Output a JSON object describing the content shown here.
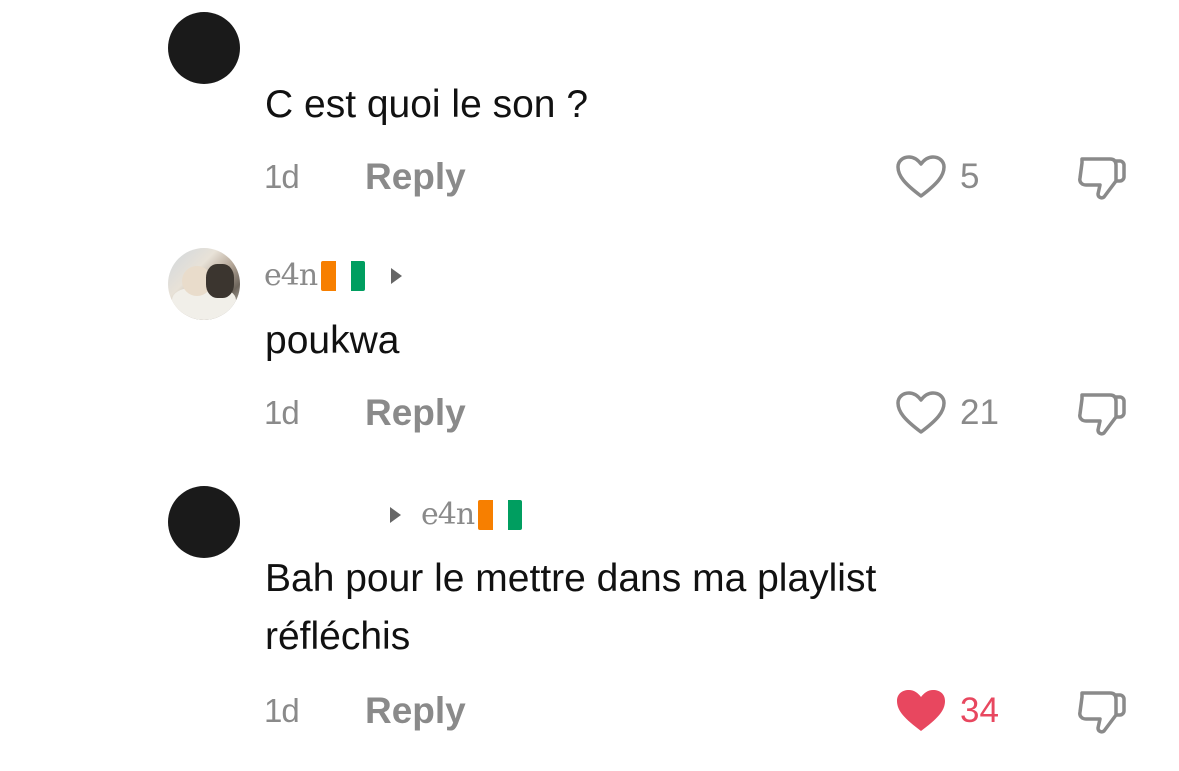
{
  "comments": [
    {
      "username": "",
      "text": "C est quoi le son ?",
      "time": "1d",
      "reply_label": "Reply",
      "like_count": "5",
      "liked": false
    },
    {
      "username": "e4n",
      "text": "poukwa",
      "time": "1d",
      "reply_label": "Reply",
      "like_count": "21",
      "liked": false
    },
    {
      "username": "e4n",
      "text_line1": "Bah pour le mettre dans ma playlist",
      "text_line2": "réfléchis",
      "time": "1d",
      "reply_label": "Reply",
      "like_count": "34",
      "liked": true
    }
  ],
  "colors": {
    "muted": "#8a8a8a",
    "liked": "#e8475f",
    "flag": [
      "#f77f00",
      "#ffffff",
      "#009e60"
    ]
  }
}
